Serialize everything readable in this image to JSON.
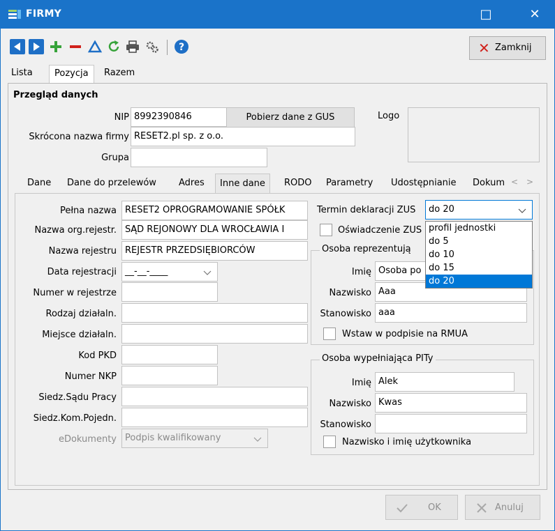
{
  "window": {
    "title": "FIRMY",
    "minimize_icon": "□",
    "close_icon": "✕"
  },
  "toolbar": {
    "close_label": "Zamknij"
  },
  "top_tabs": [
    "Lista",
    "Pozycja",
    "Razem"
  ],
  "overview": {
    "heading": "Przegląd danych",
    "nip_label": "NIP",
    "nip_value": "8992390846",
    "gus_button": "Pobierz dane z GUS",
    "logo_label": "Logo",
    "short_name_label": "Skrócona nazwa firmy",
    "short_name_value": "RESET2.pl sp. z o.o.",
    "group_label": "Grupa",
    "group_value": ""
  },
  "inner_tabs": [
    "Dane",
    "Dane do przelewów",
    "Adres",
    "Inne dane",
    "RODO",
    "Parametry",
    "Udostępnianie",
    "Dokum"
  ],
  "left_form": {
    "full_name_label": "Pełna nazwa",
    "full_name_value": "RESET2 OPROGRAMOWANIE SPÓŁK",
    "reg_org_label": "Nazwa org.rejestr.",
    "reg_org_value": "SĄD REJONOWY DLA WROCŁAWIA I",
    "reg_name_label": "Nazwa rejestru",
    "reg_name_value": "REJESTR PRZEDSIĘBIORCÓW",
    "reg_date_label": "Data rejestracji",
    "reg_date_value": "__-__-____",
    "reg_number_label": "Numer w rejestrze",
    "activity_type_label": "Rodzaj działaln.",
    "activity_place_label": "Miejsce działaln.",
    "pkd_label": "Kod PKD",
    "nkp_label": "Numer NKP",
    "labor_court_label": "Siedz.Sądu Pracy",
    "conciliation_label": "Siedz.Kom.Pojedn.",
    "edocs_label": "eDokumenty",
    "edocs_value": "Podpis kwalifikowany"
  },
  "right_form": {
    "zus_term_label": "Termin deklaracji ZUS",
    "zus_term_value": "do 20",
    "zus_options": [
      "profil jednostki",
      "do 5",
      "do 10",
      "do 15",
      "do 20"
    ],
    "zus_statement_label": "Oświadczenie ZUS",
    "rep_group_title": "Osoba reprezentują",
    "rep_first_name_label": "Imię",
    "rep_first_name_value": "Osoba po",
    "rep_last_name_label": "Nazwisko",
    "rep_last_name_value": "Aaa",
    "rep_position_label": "Stanowisko",
    "rep_position_value": "aaa",
    "rmua_label": "Wstaw w podpisie na RMUA",
    "pit_group_title": "Osoba wypełniająca PITy",
    "pit_first_name_label": "Imię",
    "pit_first_name_value": "Alek",
    "pit_last_name_label": "Nazwisko",
    "pit_last_name_value": "Kwas",
    "pit_position_label": "Stanowisko",
    "pit_position_value": "",
    "user_name_label": "Nazwisko i imię użytkownika"
  },
  "footer": {
    "ok_label": "OK",
    "cancel_label": "Anuluj"
  }
}
